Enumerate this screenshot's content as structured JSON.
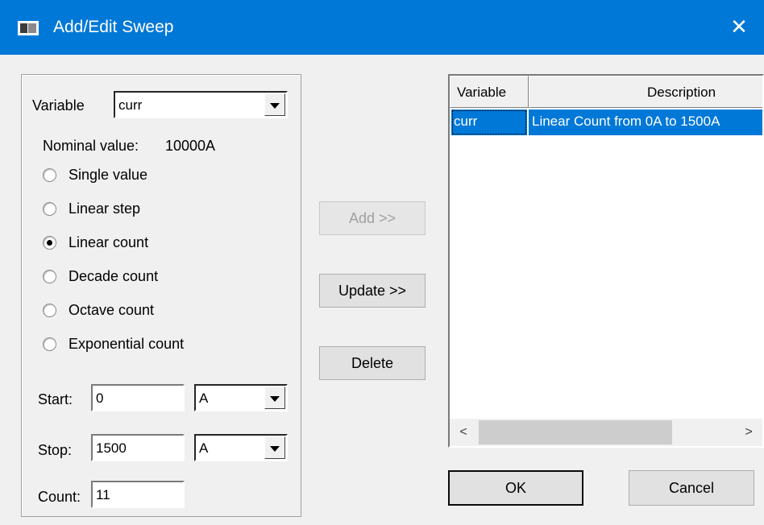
{
  "window": {
    "title": "Add/Edit Sweep",
    "close_glyph": "✕"
  },
  "variable": {
    "label": "Variable",
    "selected": "curr",
    "nominal_label": "Nominal value:",
    "nominal_value": "10000A"
  },
  "sweep_types": [
    {
      "label": "Single value",
      "checked": false
    },
    {
      "label": "Linear step",
      "checked": false
    },
    {
      "label": "Linear count",
      "checked": true
    },
    {
      "label": "Decade count",
      "checked": false
    },
    {
      "label": "Octave count",
      "checked": false
    },
    {
      "label": "Exponential count",
      "checked": false
    }
  ],
  "start": {
    "label": "Start:",
    "value": "0",
    "unit": "A"
  },
  "stop": {
    "label": "Stop:",
    "value": "1500",
    "unit": "A"
  },
  "count": {
    "label": "Count:",
    "value": "11"
  },
  "buttons": {
    "add": "Add >>",
    "update": "Update >>",
    "delete": "Delete",
    "ok": "OK",
    "cancel": "Cancel"
  },
  "list": {
    "columns": [
      "Variable",
      "Description"
    ],
    "rows": [
      {
        "variable": "curr",
        "description": "Linear Count from 0A to 1500A",
        "selected": true
      }
    ]
  },
  "scrollbar": {
    "left_glyph": "<",
    "right_glyph": ">"
  }
}
